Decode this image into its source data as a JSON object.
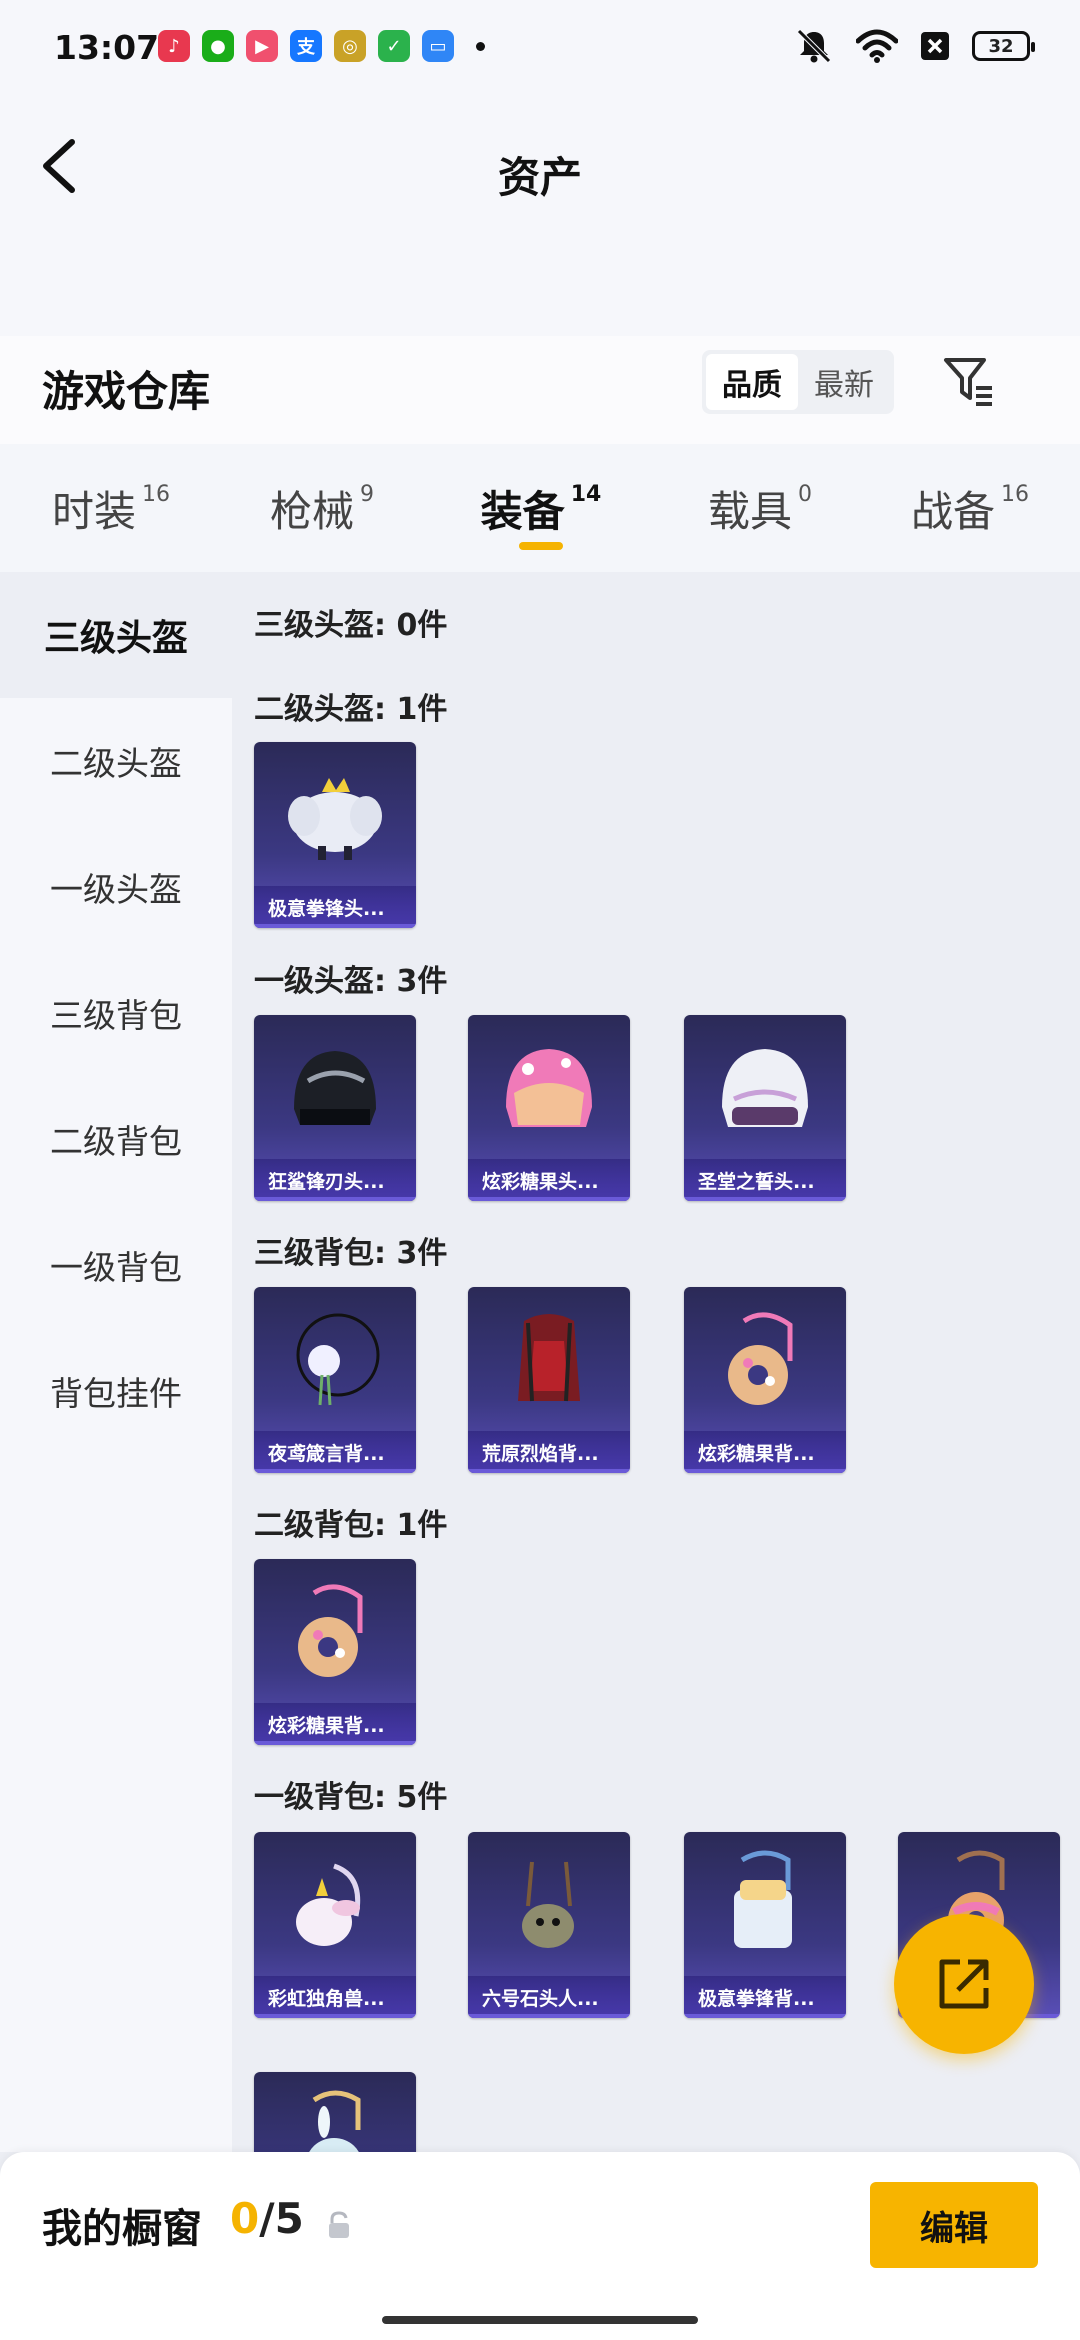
{
  "status_bar": {
    "time": "13:07",
    "apps": [
      {
        "name": "music-app-icon",
        "color": "#e8384f",
        "glyph": "♪"
      },
      {
        "name": "wechat-icon",
        "color": "#1aad19",
        "glyph": "●"
      },
      {
        "name": "video-app-icon",
        "color": "#f0506e",
        "glyph": "▶"
      },
      {
        "name": "alipay-icon",
        "color": "#1677ff",
        "glyph": "支"
      },
      {
        "name": "target-app-icon",
        "color": "#c9a227",
        "glyph": "◎"
      },
      {
        "name": "shield-app-icon",
        "color": "#2bb24c",
        "glyph": "✓"
      },
      {
        "name": "files-app-icon",
        "color": "#2f86f6",
        "glyph": "▭"
      }
    ],
    "battery": "32"
  },
  "nav": {
    "title": "资产"
  },
  "warehouse": {
    "title": "游戏仓库",
    "sort_options": [
      "品质",
      "最新"
    ],
    "sort_active": 0
  },
  "tabs": [
    {
      "label": "时装",
      "count": "16"
    },
    {
      "label": "枪械",
      "count": "9"
    },
    {
      "label": "装备",
      "count": "14",
      "active": true
    },
    {
      "label": "载具",
      "count": "0"
    },
    {
      "label": "战备",
      "count": "16"
    }
  ],
  "sidebar": {
    "items": [
      {
        "label": "三级头盔",
        "active": true
      },
      {
        "label": "二级头盔"
      },
      {
        "label": "一级头盔"
      },
      {
        "label": "三级背包"
      },
      {
        "label": "二级背包"
      },
      {
        "label": "一级背包"
      },
      {
        "label": "背包挂件"
      }
    ]
  },
  "sections": [
    {
      "title": "三级头盔: 0件",
      "items": []
    },
    {
      "title": "二级头盔: 1件",
      "items": [
        {
          "name": "极意拳锋头...",
          "icon": "white-elephant-helmet"
        }
      ]
    },
    {
      "title": "一级头盔: 3件",
      "items": [
        {
          "name": "狂鲨锋刃头...",
          "icon": "black-shark-helmet"
        },
        {
          "name": "炫彩糖果头...",
          "icon": "pink-candy-helmet"
        },
        {
          "name": "圣堂之誓头...",
          "icon": "white-templar-helmet"
        }
      ]
    },
    {
      "title": "三级背包: 3件",
      "items": [
        {
          "name": "夜鸢箴言背...",
          "icon": "night-kite-backpack"
        },
        {
          "name": "荒原烈焰背...",
          "icon": "wasteland-flame-backpack"
        },
        {
          "name": "炫彩糖果背...",
          "icon": "candy-donut-backpack"
        }
      ]
    },
    {
      "title": "二级背包: 1件",
      "items": [
        {
          "name": "炫彩糖果背...",
          "icon": "candy-donut-backpack"
        }
      ]
    },
    {
      "title": "一级背包: 5件",
      "items": [
        {
          "name": "彩虹独角兽...",
          "icon": "unicorn-backpack"
        },
        {
          "name": "六号石头人...",
          "icon": "stone-golem-backpack"
        },
        {
          "name": "极意拳锋背...",
          "icon": "fist-backpack"
        },
        {
          "name": "",
          "icon": "donut-backpack"
        },
        {
          "name": "",
          "icon": "bunny-backpack"
        }
      ]
    }
  ],
  "bottom_bar": {
    "label": "我的橱窗",
    "current": "0",
    "total": "/5",
    "edit_label": "编辑"
  },
  "colors": {
    "accent": "#f7b400",
    "card_gradient_top": "#2b2a57",
    "card_gradient_bottom": "#5a4fb8"
  }
}
